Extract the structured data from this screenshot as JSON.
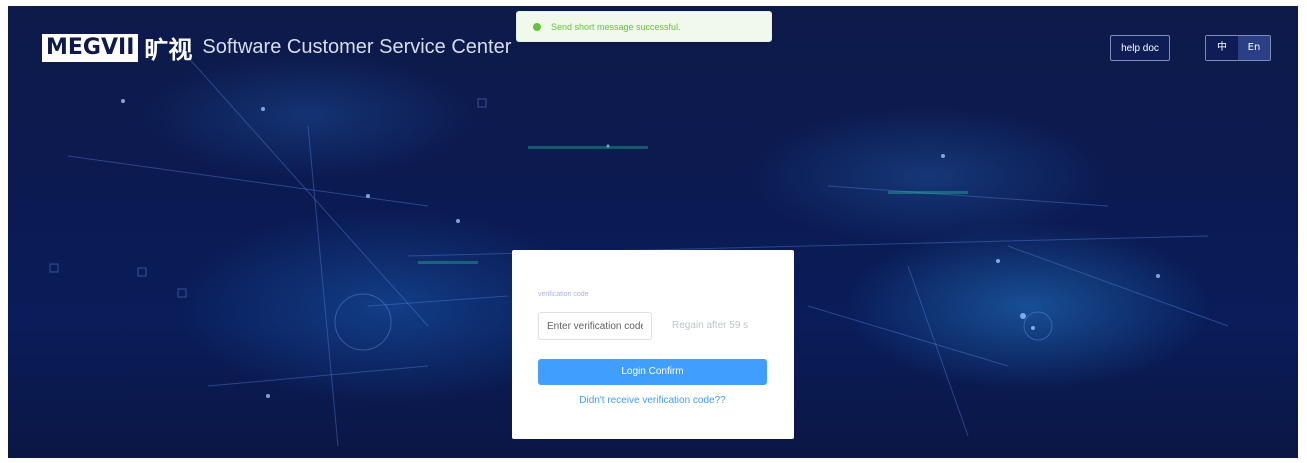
{
  "header": {
    "logo_en": "MEGVII",
    "logo_cn": "旷视",
    "app_title": "Software Customer Service Center",
    "help_label": "help doc",
    "lang_zh": "中",
    "lang_en": "En",
    "active_lang": "En"
  },
  "toast": {
    "message": "Send short message successful.",
    "status": "success",
    "color": "#67c23a"
  },
  "login_card": {
    "verification_label": "verification code",
    "code_value": "",
    "code_placeholder": "Enter verification code",
    "regain_text": "Regain after 59 s",
    "confirm_label": "Login Confirm",
    "resend_link": "Didn't receive verification code??"
  },
  "colors": {
    "background": "#0b1a52",
    "primary": "#409eff"
  }
}
